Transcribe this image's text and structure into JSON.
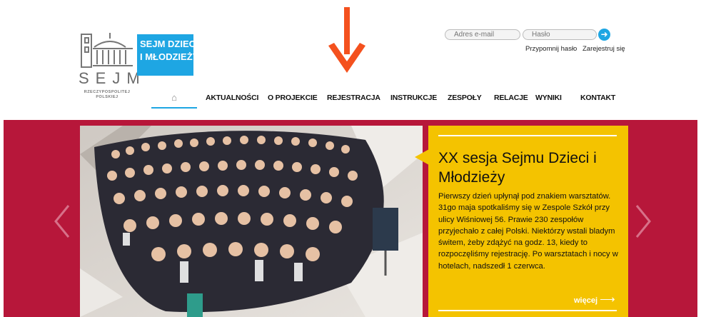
{
  "logo": {
    "word": "SEJM",
    "sub1": "RZECZYPOSPOLITEJ",
    "sub2": "POLSKIEJ"
  },
  "badge": {
    "line1": "SEJM DZIECI",
    "line2": "I MŁODZIEŻY"
  },
  "login": {
    "email_placeholder": "Adres e-mail",
    "password_placeholder": "Hasło",
    "remind": "Przypomnij hasło",
    "register": "Zarejestruj się",
    "go_icon": "arrow-right-icon"
  },
  "nav": {
    "home_icon": "home-icon",
    "items": [
      "AKTUALNOŚCI",
      "O PROJEKCIE",
      "REJESTRACJA",
      "INSTRUKCJE",
      "ZESPOŁY",
      "RELACJE",
      "WYNIKI",
      "KONTAKT"
    ]
  },
  "colors": {
    "accent": "#1ea6e3",
    "banner": "#b7173a",
    "panel": "#f4c300",
    "arrow": "#f4511e"
  },
  "slide": {
    "title": "XX sesja Sejmu Dzieci i Młodzieży",
    "text": "Pierwszy dzień upłynął pod znakiem warsztatów. 31go maja spotkaliśmy się w Zespole Szkół przy ulicy Wiśniowej 56. Prawie 230 zespołów przyjechało z całej Polski. Niektórzy wstali bladym świtem, żeby zdążyć na godz. 13, kiedy to rozpoczęliśmy rejestrację. Po warsztatach i nocy w hotelach, nadszedł 1 czerwca.",
    "more": "więcej"
  }
}
